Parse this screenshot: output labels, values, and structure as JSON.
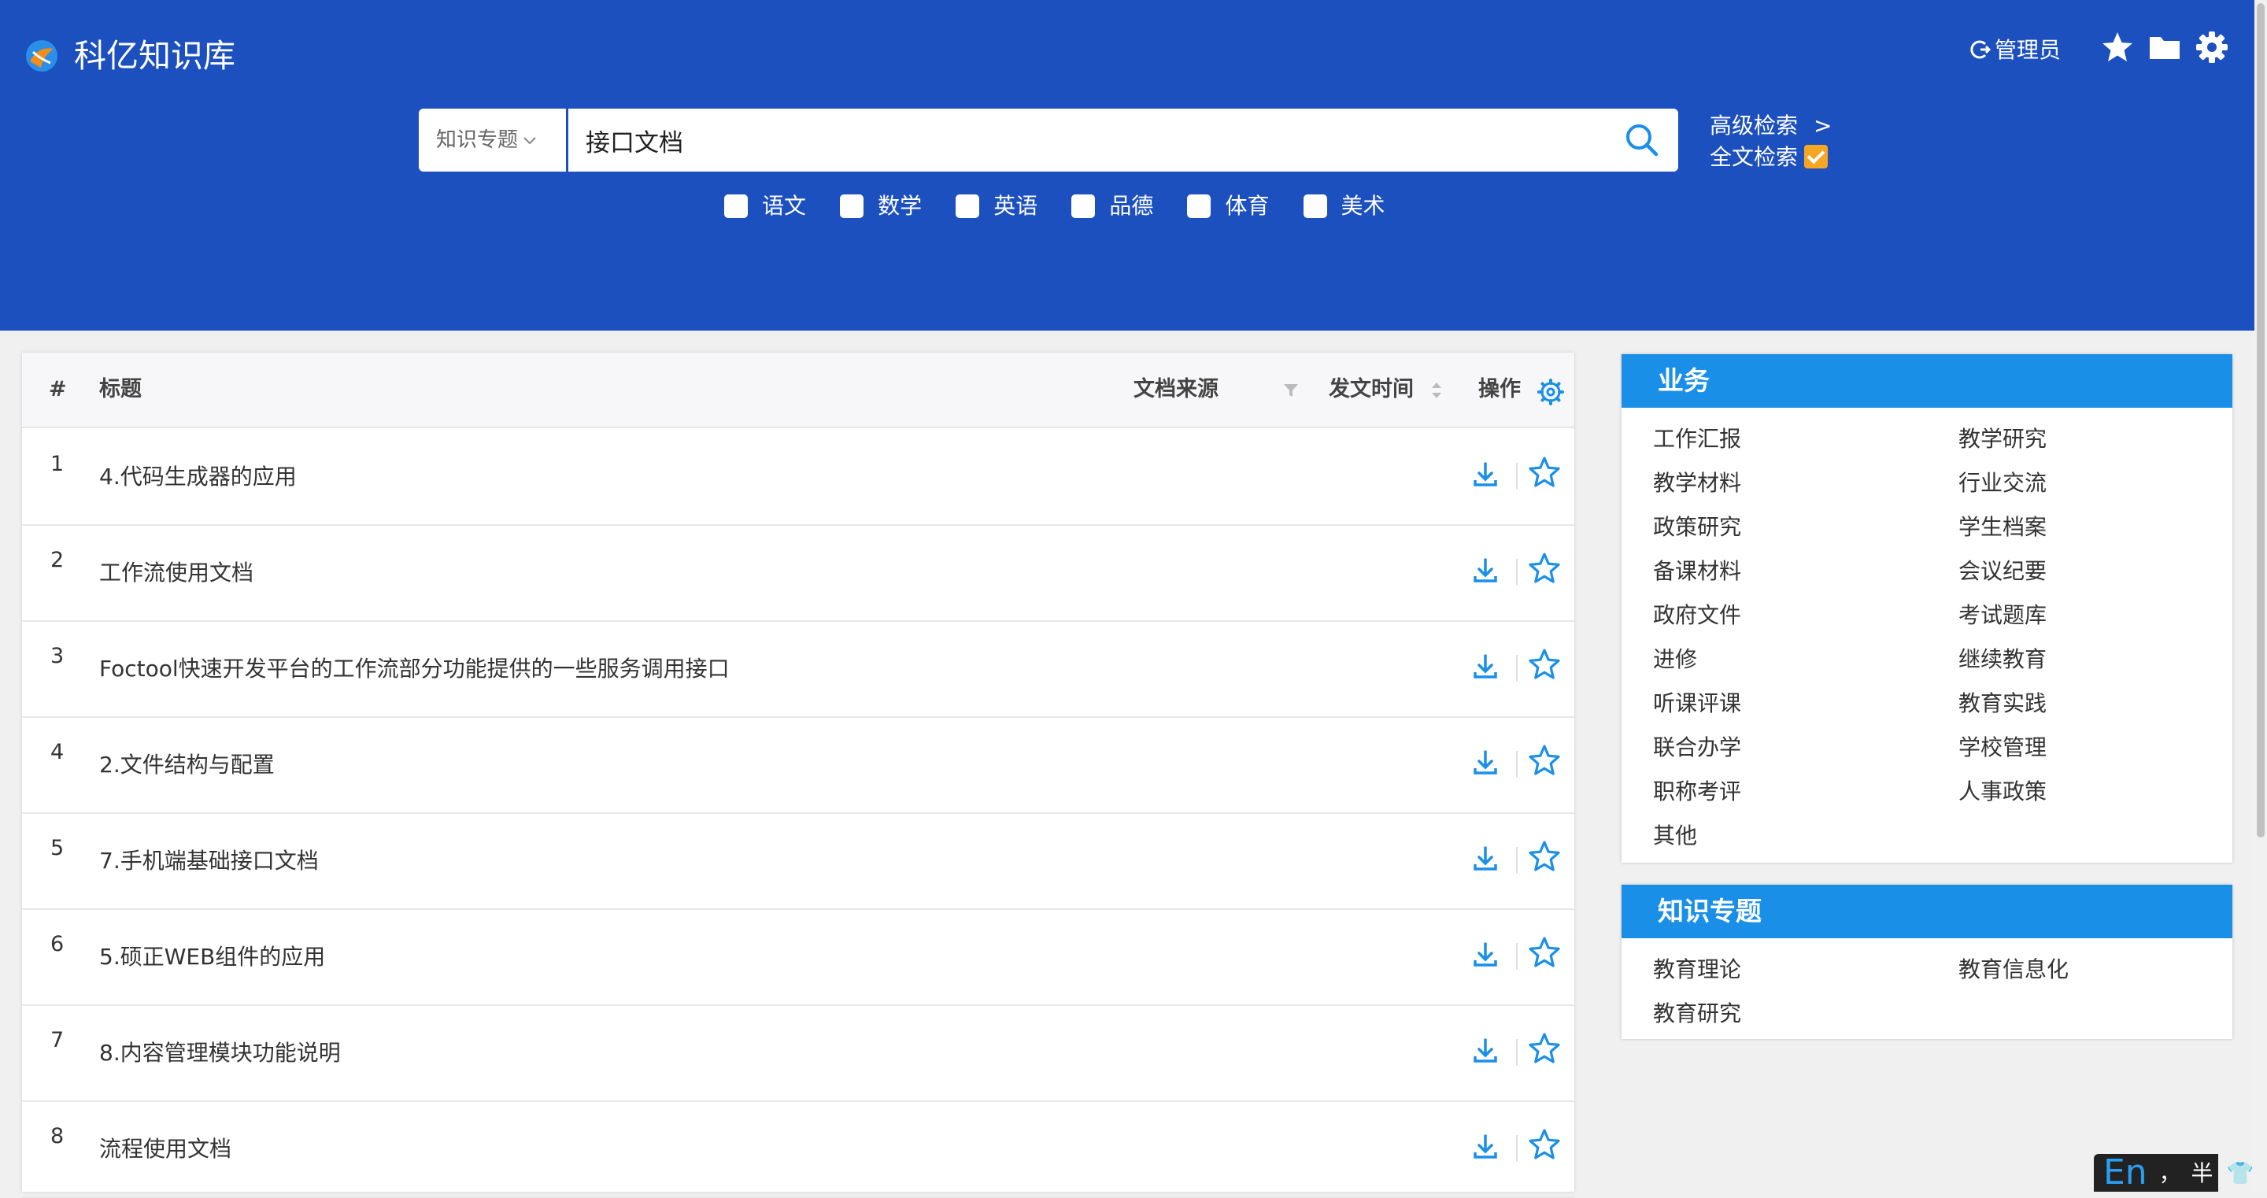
{
  "header": {
    "app_title": "科亿知识库",
    "user_label": "管理员",
    "icons": [
      "logout-icon",
      "star-icon",
      "folder-icon",
      "settings-icon"
    ]
  },
  "search": {
    "category": "知识专题",
    "query": "接口文档",
    "advanced_label": "高级检索",
    "advanced_arrow": ">",
    "fulltext_label": "全文检索",
    "fulltext_checked": true
  },
  "subjects": [
    "语文",
    "数学",
    "英语",
    "品德",
    "体育",
    "美术"
  ],
  "table": {
    "headers": {
      "index": "#",
      "title": "标题",
      "source": "文档来源",
      "date": "发文时间",
      "actions": "操作"
    },
    "rows": [
      {
        "num": "1",
        "title": "4.代码生成器的应用"
      },
      {
        "num": "2",
        "title": "工作流使用文档"
      },
      {
        "num": "3",
        "title": "Foctool快速开发平台的工作流部分功能提供的一些服务调用接口"
      },
      {
        "num": "4",
        "title": "2.文件结构与配置"
      },
      {
        "num": "5",
        "title": "7.手机端基础接口文档"
      },
      {
        "num": "6",
        "title": "5.硕正WEB组件的应用"
      },
      {
        "num": "7",
        "title": "8.内容管理模块功能说明"
      },
      {
        "num": "8",
        "title": "流程使用文档"
      }
    ]
  },
  "business_panel": {
    "title": "业务",
    "items": [
      "工作汇报",
      "教学研究",
      "教学材料",
      "行业交流",
      "政策研究",
      "学生档案",
      "备课材料",
      "会议纪要",
      "政府文件",
      "考试题库",
      "进修",
      "继续教育",
      "听课评课",
      "教育实践",
      "联合办学",
      "学校管理",
      "职称考评",
      "人事政策",
      "其他"
    ]
  },
  "topic_panel": {
    "title": "知识专题",
    "items": [
      "教育理论",
      "教育信息化",
      "教育研究"
    ]
  },
  "ime": {
    "lang": "En",
    "punct": "，",
    "width": "半"
  },
  "colors": {
    "header_bg": "#1c50bf",
    "panel_title_bg": "#1a8fe8",
    "accent_icon": "#1a8fe8",
    "checkbox_checked": "#f5a623"
  }
}
